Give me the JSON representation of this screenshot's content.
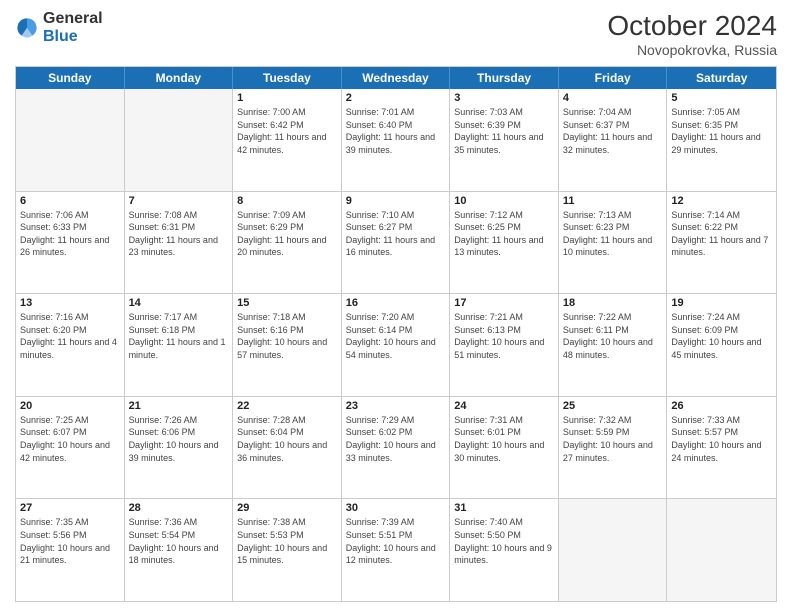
{
  "header": {
    "logo_general": "General",
    "logo_blue": "Blue",
    "month_year": "October 2024",
    "location": "Novopokrovka, Russia"
  },
  "day_headers": [
    "Sunday",
    "Monday",
    "Tuesday",
    "Wednesday",
    "Thursday",
    "Friday",
    "Saturday"
  ],
  "weeks": [
    [
      {
        "num": "",
        "info": "",
        "empty": true
      },
      {
        "num": "",
        "info": "",
        "empty": true
      },
      {
        "num": "1",
        "info": "Sunrise: 7:00 AM\nSunset: 6:42 PM\nDaylight: 11 hours and 42 minutes.",
        "empty": false
      },
      {
        "num": "2",
        "info": "Sunrise: 7:01 AM\nSunset: 6:40 PM\nDaylight: 11 hours and 39 minutes.",
        "empty": false
      },
      {
        "num": "3",
        "info": "Sunrise: 7:03 AM\nSunset: 6:39 PM\nDaylight: 11 hours and 35 minutes.",
        "empty": false
      },
      {
        "num": "4",
        "info": "Sunrise: 7:04 AM\nSunset: 6:37 PM\nDaylight: 11 hours and 32 minutes.",
        "empty": false
      },
      {
        "num": "5",
        "info": "Sunrise: 7:05 AM\nSunset: 6:35 PM\nDaylight: 11 hours and 29 minutes.",
        "empty": false
      }
    ],
    [
      {
        "num": "6",
        "info": "Sunrise: 7:06 AM\nSunset: 6:33 PM\nDaylight: 11 hours and 26 minutes.",
        "empty": false
      },
      {
        "num": "7",
        "info": "Sunrise: 7:08 AM\nSunset: 6:31 PM\nDaylight: 11 hours and 23 minutes.",
        "empty": false
      },
      {
        "num": "8",
        "info": "Sunrise: 7:09 AM\nSunset: 6:29 PM\nDaylight: 11 hours and 20 minutes.",
        "empty": false
      },
      {
        "num": "9",
        "info": "Sunrise: 7:10 AM\nSunset: 6:27 PM\nDaylight: 11 hours and 16 minutes.",
        "empty": false
      },
      {
        "num": "10",
        "info": "Sunrise: 7:12 AM\nSunset: 6:25 PM\nDaylight: 11 hours and 13 minutes.",
        "empty": false
      },
      {
        "num": "11",
        "info": "Sunrise: 7:13 AM\nSunset: 6:23 PM\nDaylight: 11 hours and 10 minutes.",
        "empty": false
      },
      {
        "num": "12",
        "info": "Sunrise: 7:14 AM\nSunset: 6:22 PM\nDaylight: 11 hours and 7 minutes.",
        "empty": false
      }
    ],
    [
      {
        "num": "13",
        "info": "Sunrise: 7:16 AM\nSunset: 6:20 PM\nDaylight: 11 hours and 4 minutes.",
        "empty": false
      },
      {
        "num": "14",
        "info": "Sunrise: 7:17 AM\nSunset: 6:18 PM\nDaylight: 11 hours and 1 minute.",
        "empty": false
      },
      {
        "num": "15",
        "info": "Sunrise: 7:18 AM\nSunset: 6:16 PM\nDaylight: 10 hours and 57 minutes.",
        "empty": false
      },
      {
        "num": "16",
        "info": "Sunrise: 7:20 AM\nSunset: 6:14 PM\nDaylight: 10 hours and 54 minutes.",
        "empty": false
      },
      {
        "num": "17",
        "info": "Sunrise: 7:21 AM\nSunset: 6:13 PM\nDaylight: 10 hours and 51 minutes.",
        "empty": false
      },
      {
        "num": "18",
        "info": "Sunrise: 7:22 AM\nSunset: 6:11 PM\nDaylight: 10 hours and 48 minutes.",
        "empty": false
      },
      {
        "num": "19",
        "info": "Sunrise: 7:24 AM\nSunset: 6:09 PM\nDaylight: 10 hours and 45 minutes.",
        "empty": false
      }
    ],
    [
      {
        "num": "20",
        "info": "Sunrise: 7:25 AM\nSunset: 6:07 PM\nDaylight: 10 hours and 42 minutes.",
        "empty": false
      },
      {
        "num": "21",
        "info": "Sunrise: 7:26 AM\nSunset: 6:06 PM\nDaylight: 10 hours and 39 minutes.",
        "empty": false
      },
      {
        "num": "22",
        "info": "Sunrise: 7:28 AM\nSunset: 6:04 PM\nDaylight: 10 hours and 36 minutes.",
        "empty": false
      },
      {
        "num": "23",
        "info": "Sunrise: 7:29 AM\nSunset: 6:02 PM\nDaylight: 10 hours and 33 minutes.",
        "empty": false
      },
      {
        "num": "24",
        "info": "Sunrise: 7:31 AM\nSunset: 6:01 PM\nDaylight: 10 hours and 30 minutes.",
        "empty": false
      },
      {
        "num": "25",
        "info": "Sunrise: 7:32 AM\nSunset: 5:59 PM\nDaylight: 10 hours and 27 minutes.",
        "empty": false
      },
      {
        "num": "26",
        "info": "Sunrise: 7:33 AM\nSunset: 5:57 PM\nDaylight: 10 hours and 24 minutes.",
        "empty": false
      }
    ],
    [
      {
        "num": "27",
        "info": "Sunrise: 7:35 AM\nSunset: 5:56 PM\nDaylight: 10 hours and 21 minutes.",
        "empty": false
      },
      {
        "num": "28",
        "info": "Sunrise: 7:36 AM\nSunset: 5:54 PM\nDaylight: 10 hours and 18 minutes.",
        "empty": false
      },
      {
        "num": "29",
        "info": "Sunrise: 7:38 AM\nSunset: 5:53 PM\nDaylight: 10 hours and 15 minutes.",
        "empty": false
      },
      {
        "num": "30",
        "info": "Sunrise: 7:39 AM\nSunset: 5:51 PM\nDaylight: 10 hours and 12 minutes.",
        "empty": false
      },
      {
        "num": "31",
        "info": "Sunrise: 7:40 AM\nSunset: 5:50 PM\nDaylight: 10 hours and 9 minutes.",
        "empty": false
      },
      {
        "num": "",
        "info": "",
        "empty": true
      },
      {
        "num": "",
        "info": "",
        "empty": true
      }
    ]
  ]
}
